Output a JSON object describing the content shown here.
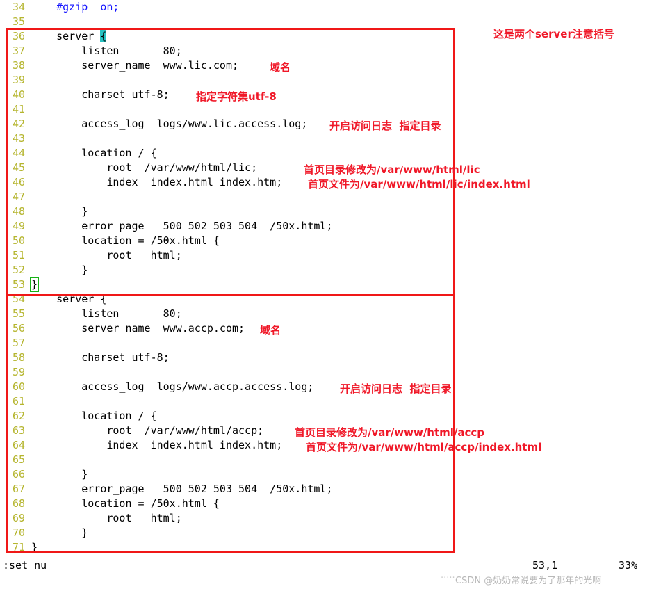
{
  "editor": {
    "app": "vim",
    "lines": [
      {
        "no": "34",
        "text": "    #gzip  on;",
        "kind": "comment"
      },
      {
        "no": "35",
        "text": ""
      },
      {
        "no": "36",
        "text": "    server {",
        "brace_cyan": true
      },
      {
        "no": "37",
        "text": "        listen       80;"
      },
      {
        "no": "38",
        "text": "        server_name  www.lic.com;"
      },
      {
        "no": "39",
        "text": ""
      },
      {
        "no": "40",
        "text": "        charset utf-8;"
      },
      {
        "no": "41",
        "text": ""
      },
      {
        "no": "42",
        "text": "        access_log  logs/www.lic.access.log;"
      },
      {
        "no": "43",
        "text": ""
      },
      {
        "no": "44",
        "text": "        location / {"
      },
      {
        "no": "45",
        "text": "            root  /var/www/html/lic;"
      },
      {
        "no": "46",
        "text": "            index  index.html index.htm;"
      },
      {
        "no": "47",
        "text": ""
      },
      {
        "no": "48",
        "text": "        }"
      },
      {
        "no": "49",
        "text": "        error_page   500 502 503 504  /50x.html;"
      },
      {
        "no": "50",
        "text": "        location = /50x.html {"
      },
      {
        "no": "51",
        "text": "            root   html;"
      },
      {
        "no": "52",
        "text": "        }"
      },
      {
        "no": "53",
        "text": "}",
        "brace_green": true
      },
      {
        "no": "54",
        "text": "    server {"
      },
      {
        "no": "55",
        "text": "        listen       80;"
      },
      {
        "no": "56",
        "text": "        server_name  www.accp.com;"
      },
      {
        "no": "57",
        "text": ""
      },
      {
        "no": "58",
        "text": "        charset utf-8;"
      },
      {
        "no": "59",
        "text": ""
      },
      {
        "no": "60",
        "text": "        access_log  logs/www.accp.access.log;"
      },
      {
        "no": "61",
        "text": ""
      },
      {
        "no": "62",
        "text": "        location / {"
      },
      {
        "no": "63",
        "text": "            root  /var/www/html/accp;"
      },
      {
        "no": "64",
        "text": "            index  index.html index.htm;"
      },
      {
        "no": "65",
        "text": ""
      },
      {
        "no": "66",
        "text": "        }"
      },
      {
        "no": "67",
        "text": "        error_page   500 502 503 504  /50x.html;"
      },
      {
        "no": "68",
        "text": "        location = /50x.html {"
      },
      {
        "no": "69",
        "text": "            root   html;"
      },
      {
        "no": "70",
        "text": "        }"
      },
      {
        "no": "71",
        "text": "}"
      }
    ]
  },
  "annotations": {
    "title_note": "这是两个server注意括号",
    "domain_1": "域名",
    "charset_note": "指定字符集utf-8",
    "accesslog_note_1": "开启访问日志  指定目录",
    "root_note_1": "首页目录修改为/var/www/html/lic",
    "index_note_1": "首页文件为/var/www/html/lic/index.html",
    "domain_2": "域名",
    "accesslog_note_2": "开启访问日志  指定目录",
    "root_note_2": "首页目录修改为/var/www/html/accp",
    "index_note_2": "首页文件为/var/www/html/accp/index.html"
  },
  "statusline": {
    "command": ":set nu",
    "cursor": "53,1",
    "percent": "33%"
  },
  "watermark": {
    "dots": "·····",
    "text": "CSDN @奶奶常说要为了那年的光啊"
  },
  "colors": {
    "annotation_red": "#f01828",
    "box_red": "#f01818",
    "lineno_yellow": "#b5b52e",
    "comment_blue": "#1414ff",
    "brace_cyan": "#25c2c2",
    "brace_green": "#17b217"
  }
}
